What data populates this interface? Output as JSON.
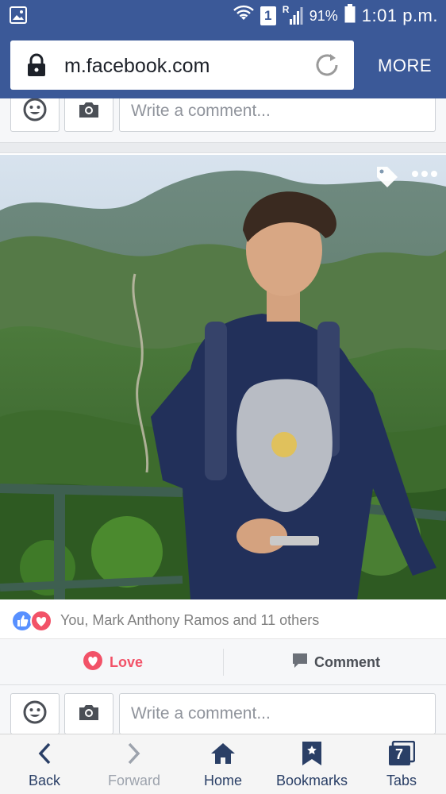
{
  "status_bar": {
    "wifi_icon": "wifi-icon",
    "sim_slot": "1",
    "signal_label": "R",
    "battery": "91%",
    "time": "1:01 p.m."
  },
  "browser": {
    "url": "m.facebook.com",
    "more_label": "MORE"
  },
  "composer_top": {
    "placeholder": "Write a comment..."
  },
  "post": {
    "reactions_text": "You, Mark Anthony Ramos and 11 others",
    "reaction_icons": [
      "like-icon",
      "love-icon"
    ],
    "love_label": "Love",
    "comment_label": "Comment"
  },
  "composer_bottom": {
    "placeholder": "Write a comment..."
  },
  "bottom_nav": {
    "back": "Back",
    "forward": "Forward",
    "home": "Home",
    "bookmarks": "Bookmarks",
    "tabs": "Tabs",
    "tab_count": "7"
  },
  "colors": {
    "brand": "#3b5998",
    "love": "#f25268",
    "like": "#5890ff"
  }
}
